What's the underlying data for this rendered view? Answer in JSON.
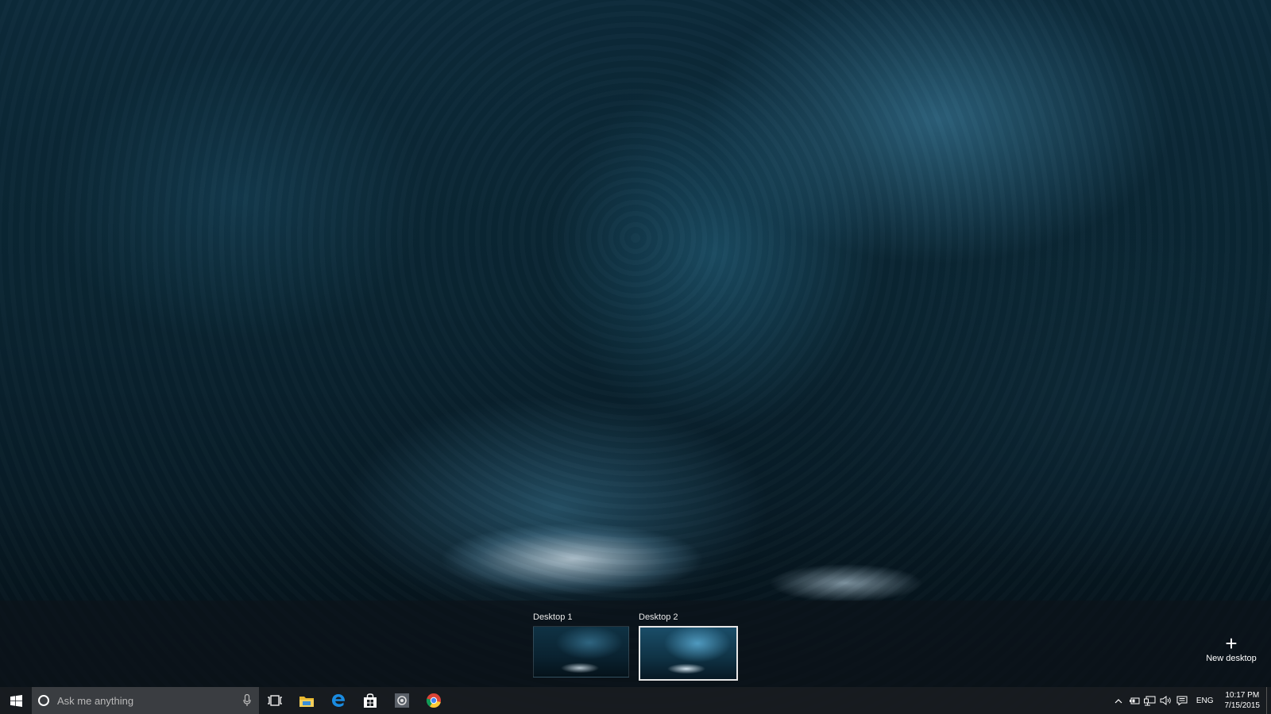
{
  "desktops": [
    {
      "label": "Desktop 1",
      "active": false
    },
    {
      "label": "Desktop 2",
      "active": true
    }
  ],
  "new_desktop": {
    "icon": "plus-icon",
    "label": "New desktop"
  },
  "taskbar": {
    "start_icon": "windows-logo-icon",
    "search": {
      "placeholder": "Ask me anything",
      "icon": "cortana-circle-icon",
      "mic_icon": "microphone-icon"
    },
    "task_view_icon": "task-view-icon",
    "pinned_apps": [
      {
        "name": "File Explorer",
        "icon": "folder-icon"
      },
      {
        "name": "Microsoft Edge",
        "icon": "edge-icon"
      },
      {
        "name": "Store",
        "icon": "store-bag-icon"
      },
      {
        "name": "Settings",
        "icon": "settings-icon"
      },
      {
        "name": "Google Chrome",
        "icon": "chrome-icon"
      }
    ],
    "tray": {
      "overflow_icon": "chevron-up-icon",
      "icons": [
        "battery-icon",
        "network-icon",
        "volume-icon",
        "action-center-icon"
      ],
      "language": "ENG",
      "time": "10:17 PM",
      "date": "7/15/2015"
    }
  },
  "colors": {
    "taskbar": "#181c20",
    "search_box": "#3a3d41",
    "accent_folder": "#f0c040",
    "edge_blue": "#1a8be0"
  }
}
